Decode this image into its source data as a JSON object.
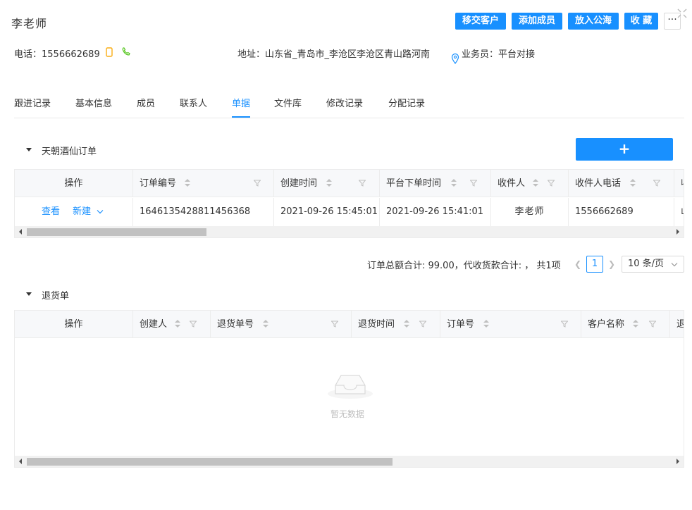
{
  "header": {
    "title": "李老师",
    "buttons": [
      "移交客户",
      "添加成员",
      "放入公海",
      "收 藏"
    ],
    "more_label": "···",
    "phone_label": "电话：",
    "phone": "1556662689",
    "address_label": "地址：",
    "address": "山东省_青岛市_李沧区李沧区青山路河南",
    "salesman_label": "业务员：",
    "salesman": "平台对接"
  },
  "tabs": [
    "跟进记录",
    "基本信息",
    "成员",
    "联系人",
    "单据",
    "文件库",
    "修改记录",
    "分配记录"
  ],
  "active_tab": "单据",
  "orders": {
    "title": "天朝酒仙订单",
    "add_label": "+",
    "columns": [
      "操作",
      "订单编号",
      "创建时间",
      "平台下单时间",
      "收件人",
      "收件人电话",
      "收"
    ],
    "rows": [
      {
        "view": "查看",
        "create": "新建",
        "order_no": "1646135428811456368",
        "created": "2021-09-26 15:45:01",
        "platform_time": "2021-09-26 15:41:01",
        "receiver": "李老师",
        "phone": "1556662689",
        "extra": "山"
      }
    ],
    "summary": "订单总额合计: 99.00，代收货款合计: ，  共1项",
    "page": "1",
    "page_size": "10 条/页"
  },
  "returns": {
    "title": "退货单",
    "columns": [
      "操作",
      "创建人",
      "退货单号",
      "退货时间",
      "订单号",
      "客户名称",
      "退"
    ],
    "empty": "暂无数据"
  },
  "colors": {
    "accent": "#1890ff",
    "phone_icon": "#faad14",
    "call_icon": "#52c41a"
  }
}
